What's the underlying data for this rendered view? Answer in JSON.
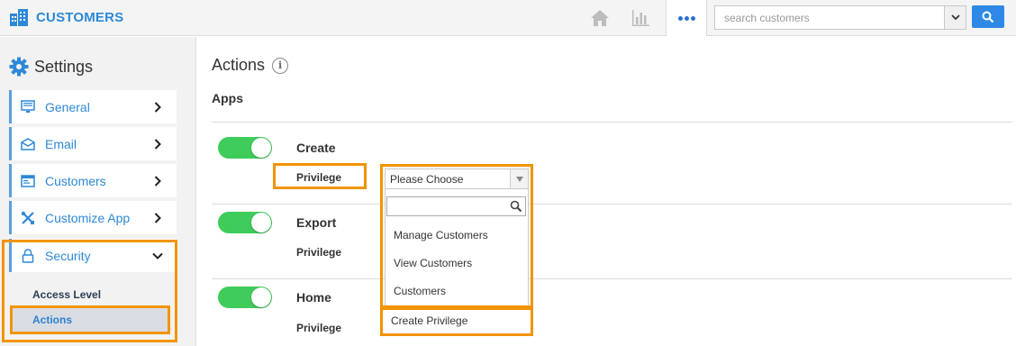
{
  "header": {
    "app_title": "CUSTOMERS",
    "search_placeholder": "search customers"
  },
  "sidebar": {
    "title": "Settings",
    "items": [
      {
        "label": "General",
        "icon": "monitor-icon"
      },
      {
        "label": "Email",
        "icon": "envelope-icon"
      },
      {
        "label": "Customers",
        "icon": "window-icon"
      },
      {
        "label": "Customize App",
        "icon": "tools-icon"
      },
      {
        "label": "Security",
        "icon": "lock-icon"
      }
    ],
    "security_sub": [
      "Access Level",
      "Actions"
    ]
  },
  "main": {
    "title": "Actions",
    "section": "Apps",
    "actions": [
      {
        "name": "Create",
        "privilege_label": "Privilege",
        "enabled": true
      },
      {
        "name": "Export",
        "privilege_label": "Privilege",
        "enabled": true
      },
      {
        "name": "Home",
        "privilege_label": "Privilege",
        "enabled": true
      }
    ]
  },
  "dropdown": {
    "selected": "Please Choose",
    "options": [
      "Manage Customers",
      "View Customers",
      "Customers"
    ],
    "create_label": "Create Privilege"
  },
  "colors": {
    "brand": "#2d89d8",
    "toggle_on": "#3fcc5a",
    "highlight": "#f29400"
  }
}
